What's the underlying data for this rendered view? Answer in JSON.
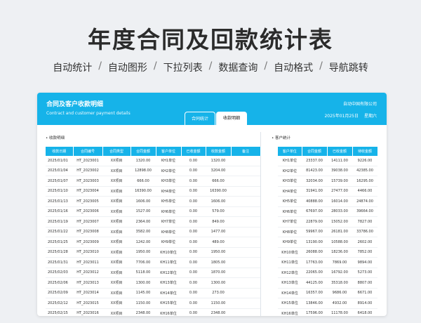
{
  "hero": {
    "title": "年度合同及回款统计表",
    "features": [
      "自动统计",
      "自动图形",
      "下拉列表",
      "数据查询",
      "自动格式",
      "导航跳转"
    ],
    "separator": "/"
  },
  "dashboard": {
    "title": "合同及客户收款明细",
    "subtitle": "Contract and customer payment details",
    "company": "自动中国有限公司",
    "date": "2025年01月25日",
    "weekday": "星期六",
    "tabs": [
      "合同统计",
      "收款明细"
    ],
    "active_tab": "合同统计"
  },
  "receipts": {
    "section_label": "收款明细",
    "columns": [
      "收款日期",
      "合同编号",
      "合同类型",
      "合同金额",
      "客户单位",
      "已收金额",
      "收款金额",
      "备注"
    ],
    "rows": [
      [
        "2025/01/01",
        "HT_2023001",
        "XX项目",
        "1320.00",
        "KH1单位",
        "0.00",
        "1320.00",
        ""
      ],
      [
        "2025/01/04",
        "HT_2023002",
        "XX项目",
        "12898.00",
        "KH2单位",
        "0.00",
        "3204.00",
        ""
      ],
      [
        "2025/01/07",
        "HT_2023003",
        "XX项目",
        "666.00",
        "KH3单位",
        "0.00",
        "666.00",
        ""
      ],
      [
        "2025/01/10",
        "HT_2023004",
        "XX项目",
        "16390.00",
        "KH4单位",
        "0.00",
        "16390.00",
        ""
      ],
      [
        "2025/01/13",
        "HT_2023005",
        "XX项目",
        "1606.00",
        "KH5单位",
        "0.00",
        "1606.00",
        ""
      ],
      [
        "2025/01/16",
        "HT_2023006",
        "XX项目",
        "1527.00",
        "KH6单位",
        "0.00",
        "579.00",
        ""
      ],
      [
        "2025/01/19",
        "HT_2023007",
        "XX项目",
        "2364.00",
        "KH7单位",
        "0.00",
        "849.00",
        ""
      ],
      [
        "2025/01/22",
        "HT_2023008",
        "XX项目",
        "3582.00",
        "KH8单位",
        "0.00",
        "1477.00",
        ""
      ],
      [
        "2025/01/25",
        "HT_2023009",
        "XX项目",
        "1242.00",
        "KH9单位",
        "0.00",
        "489.00",
        ""
      ],
      [
        "2025/01/28",
        "HT_2023010",
        "XX项目",
        "1950.00",
        "KH10单位",
        "0.00",
        "1950.00",
        ""
      ],
      [
        "2025/01/31",
        "HT_2023011",
        "XX项目",
        "7706.00",
        "KH11单位",
        "0.00",
        "1805.00",
        ""
      ],
      [
        "2025/02/03",
        "HT_2023012",
        "XX项目",
        "5118.00",
        "KH12单位",
        "0.00",
        "1870.00",
        ""
      ],
      [
        "2025/02/06",
        "HT_2023013",
        "XX项目",
        "1300.00",
        "KH13单位",
        "0.00",
        "1300.00",
        ""
      ],
      [
        "2025/02/09",
        "HT_2023014",
        "XX项目",
        "1145.00",
        "KH14单位",
        "0.00",
        "273.00",
        ""
      ],
      [
        "2025/02/12",
        "HT_2023015",
        "XX项目",
        "1150.00",
        "KH15单位",
        "0.00",
        "1150.00",
        ""
      ],
      [
        "2025/02/15",
        "HT_2023016",
        "XX项目",
        "2348.00",
        "KH16单位",
        "0.00",
        "2348.00",
        ""
      ]
    ]
  },
  "customers": {
    "section_label": "客户统计",
    "columns": [
      "客户单位",
      "合同金额",
      "已收金额",
      "待收金额"
    ],
    "rows": [
      [
        "KH1单位",
        "23337.00",
        "14111.00",
        "9226.00"
      ],
      [
        "KH2单位",
        "81423.00",
        "39038.00",
        "42385.00"
      ],
      [
        "KH3单位",
        "32034.00",
        "15739.00",
        "16295.00"
      ],
      [
        "KH4单位",
        "31941.00",
        "27477.00",
        "4466.00"
      ],
      [
        "KH5单位",
        "40888.00",
        "16014.00",
        "24874.00"
      ],
      [
        "KH6单位",
        "67697.00",
        "28033.00",
        "39664.00"
      ],
      [
        "KH7单位",
        "22879.00",
        "15052.00",
        "7827.00"
      ],
      [
        "KH8单位",
        "59967.00",
        "26181.00",
        "33786.00"
      ],
      [
        "KH9单位",
        "13190.00",
        "10588.00",
        "2602.00"
      ],
      [
        "KH10单位",
        "26088.00",
        "18236.00",
        "7852.00"
      ],
      [
        "KH11单位",
        "17763.00",
        "7869.00",
        "9894.00"
      ],
      [
        "KH12单位",
        "22065.00",
        "16792.00",
        "5273.00"
      ],
      [
        "KH13单位",
        "44125.00",
        "35318.00",
        "8807.00"
      ],
      [
        "KH14单位",
        "16357.00",
        "9686.00",
        "6671.00"
      ],
      [
        "KH15单位",
        "13846.00",
        "4932.00",
        "8914.00"
      ],
      [
        "KH16单位",
        "17596.00",
        "11178.00",
        "6418.00"
      ]
    ]
  }
}
